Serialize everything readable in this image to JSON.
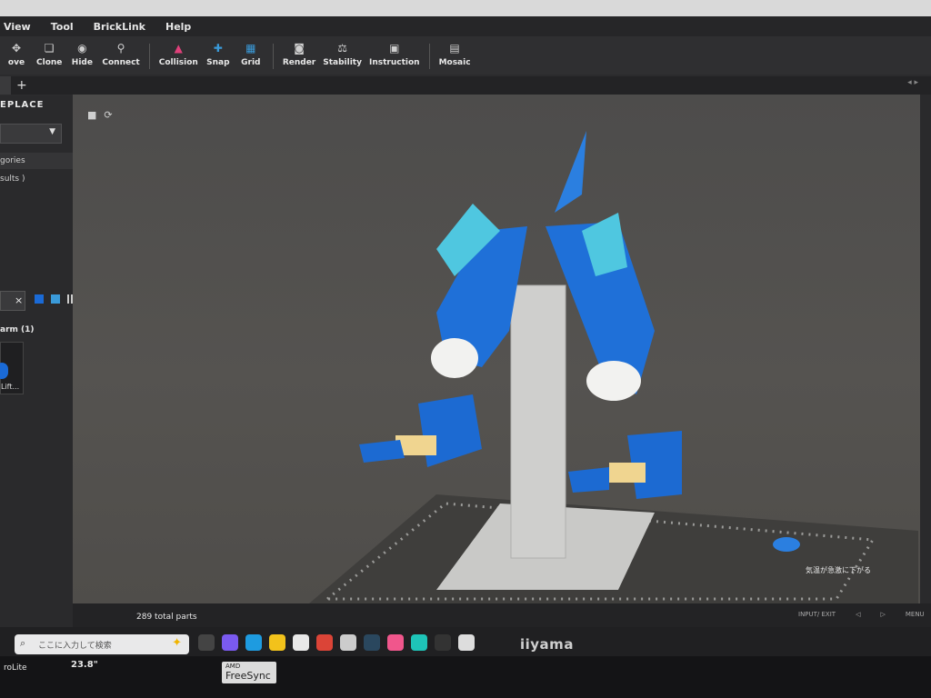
{
  "menubar": [
    "View",
    "Tool",
    "BrickLink",
    "Help"
  ],
  "toolbar": {
    "items": [
      {
        "label": "ove",
        "icon": "move-icon"
      },
      {
        "label": "Clone",
        "icon": "clone-icon"
      },
      {
        "label": "Hide",
        "icon": "hide-icon"
      },
      {
        "label": "Connect",
        "icon": "connect-icon"
      },
      {
        "label": "Collision",
        "icon": "collision-icon"
      },
      {
        "label": "Snap",
        "icon": "snap-icon"
      },
      {
        "label": "Grid",
        "icon": "grid-icon"
      },
      {
        "label": "Render",
        "icon": "render-icon"
      },
      {
        "label": "Stability",
        "icon": "stability-icon"
      },
      {
        "label": "Instruction",
        "icon": "instruction-icon"
      },
      {
        "label": "Mosaic",
        "icon": "mosaic-icon"
      }
    ]
  },
  "tabs": {
    "add_label": "+",
    "nav": "◂ ▸"
  },
  "sidebar": {
    "header": "EPLACE",
    "category_label": "gories",
    "results_label": "sults )",
    "group_label": "arm (1)",
    "tile_label": "Lift...",
    "clear_label": "×"
  },
  "status": {
    "parts_count": "289 total parts"
  },
  "taskbar": {
    "search_placeholder": "ここに入力して検索",
    "weather_text": "気温が急激に下がる"
  },
  "monitor": {
    "brand": "iiyama",
    "size": "23.8\"",
    "freesync_top": "AMD",
    "freesync_bottom": "FreeSync",
    "sticker": "roLite",
    "buttons": [
      "INPUT/ EXIT",
      "◁",
      "▷",
      "MENU"
    ]
  },
  "colors": {
    "accent_blue": "#1a6ad6",
    "collision_pink": "#e0407a",
    "snap_blue": "#3a9ad9"
  }
}
